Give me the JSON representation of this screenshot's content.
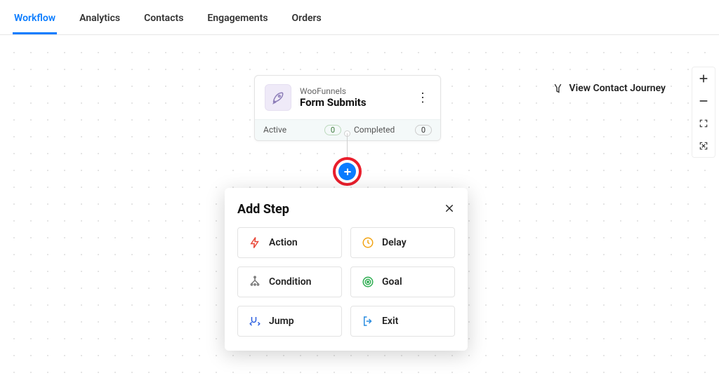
{
  "tabs": [
    {
      "label": "Workflow",
      "active": true
    },
    {
      "label": "Analytics",
      "active": false
    },
    {
      "label": "Contacts",
      "active": false
    },
    {
      "label": "Engagements",
      "active": false
    },
    {
      "label": "Orders",
      "active": false
    }
  ],
  "view_journey_label": "View Contact Journey",
  "trigger": {
    "source": "WooFunnels",
    "title": "Form Submits",
    "stats": {
      "active_label": "Active",
      "active_value": "0",
      "completed_label": "Completed",
      "completed_value": "0"
    }
  },
  "add_step_popover": {
    "title": "Add Step",
    "options": [
      {
        "key": "action",
        "label": "Action"
      },
      {
        "key": "delay",
        "label": "Delay"
      },
      {
        "key": "condition",
        "label": "Condition"
      },
      {
        "key": "goal",
        "label": "Goal"
      },
      {
        "key": "jump",
        "label": "Jump"
      },
      {
        "key": "exit",
        "label": "Exit"
      }
    ]
  }
}
